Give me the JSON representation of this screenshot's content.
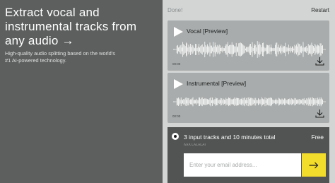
{
  "hero": {
    "title": "Extract vocal and instrumental tracks from any audio →",
    "subtitle": "High-quality audio splitting based on the world's #1 AI-powered technology."
  },
  "header": {
    "done_label": "Done!",
    "restart_label": "Restart"
  },
  "tracks": [
    {
      "title": "Vocal [Preview]",
      "time": "00:00",
      "icon": "play-icon",
      "action_icon": "download-icon"
    },
    {
      "title": "Instrumental [Preview]",
      "time": "00:00",
      "icon": "play-icon",
      "action_icon": "download-icon"
    }
  ],
  "plan": {
    "label": "3 input tracks and 10 minutes total",
    "price": "Free",
    "small_text": "ΛΛΛ LALALAI",
    "email_placeholder": "Enter your email address...",
    "submit_icon": "arrow-right-icon"
  },
  "colors": {
    "left_panel": "#5d5f5f",
    "right_panel": "#d3d5d5",
    "track_card": "#a9acac",
    "plan_panel": "#525454",
    "accent": "#f2dc2c"
  }
}
